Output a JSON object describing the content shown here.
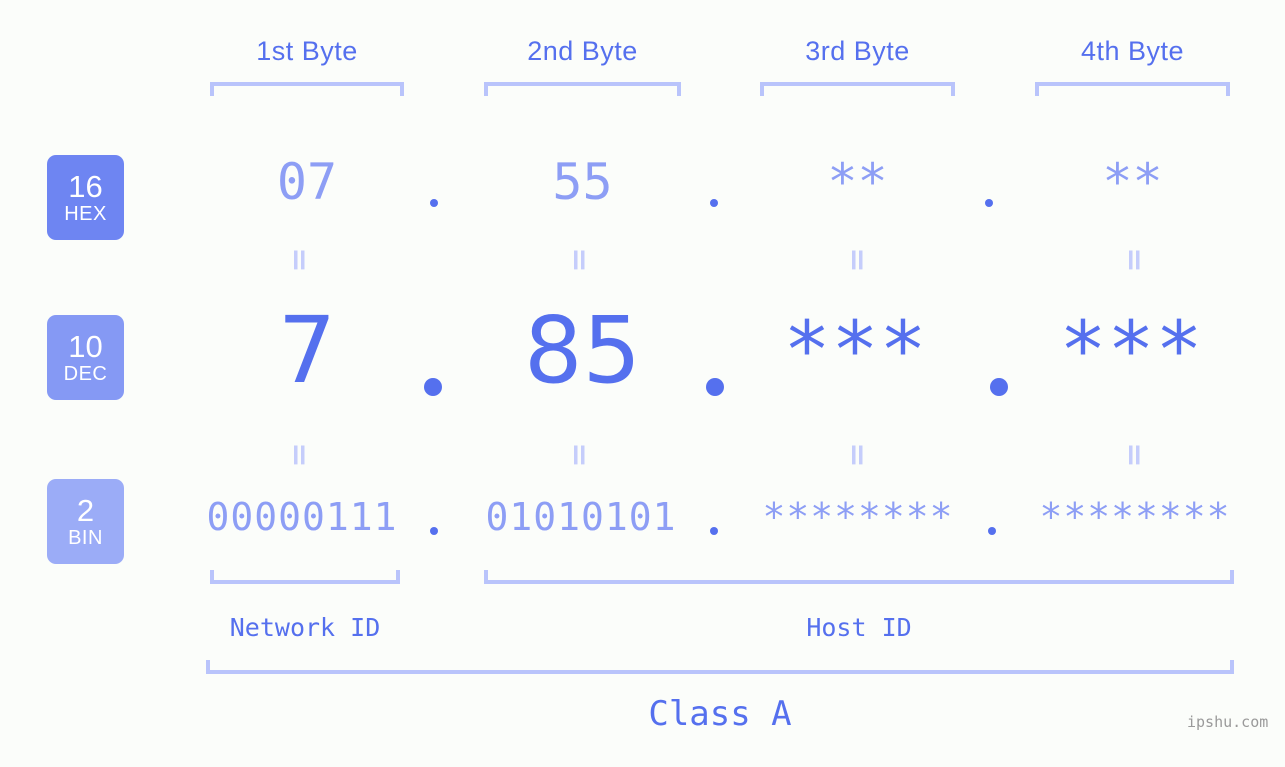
{
  "meta": {
    "background": "#fbfdfa",
    "accent_strong": "#5570ee",
    "accent_mid": "#8d9ef5",
    "accent_light": "#b9c4fb",
    "watermark": "ipshu.com"
  },
  "byte_headers": [
    {
      "label": "1st Byte"
    },
    {
      "label": "2nd Byte"
    },
    {
      "label": "3rd Byte"
    },
    {
      "label": "4th Byte"
    }
  ],
  "bases": [
    {
      "number": "16",
      "name": "HEX",
      "color": "#6e85f2"
    },
    {
      "number": "10",
      "name": "DEC",
      "color": "#8599f4"
    },
    {
      "number": "2",
      "name": "BIN",
      "color": "#9bacf7"
    }
  ],
  "rows": {
    "hex": {
      "values": [
        "07",
        "55",
        "**",
        "**"
      ],
      "separator": "."
    },
    "dec": {
      "values": [
        "7",
        "85",
        "***",
        "***"
      ],
      "separator": "."
    },
    "bin": {
      "values": [
        "00000111",
        "01010101",
        "********",
        "********"
      ],
      "separator": "."
    }
  },
  "equals_symbol": "=",
  "segments": {
    "network_id": {
      "label": "Network ID",
      "bytes": [
        1
      ]
    },
    "host_id": {
      "label": "Host ID",
      "bytes": [
        2,
        3,
        4
      ]
    },
    "class": {
      "label": "Class A",
      "bytes": [
        1,
        2,
        3,
        4
      ]
    }
  }
}
